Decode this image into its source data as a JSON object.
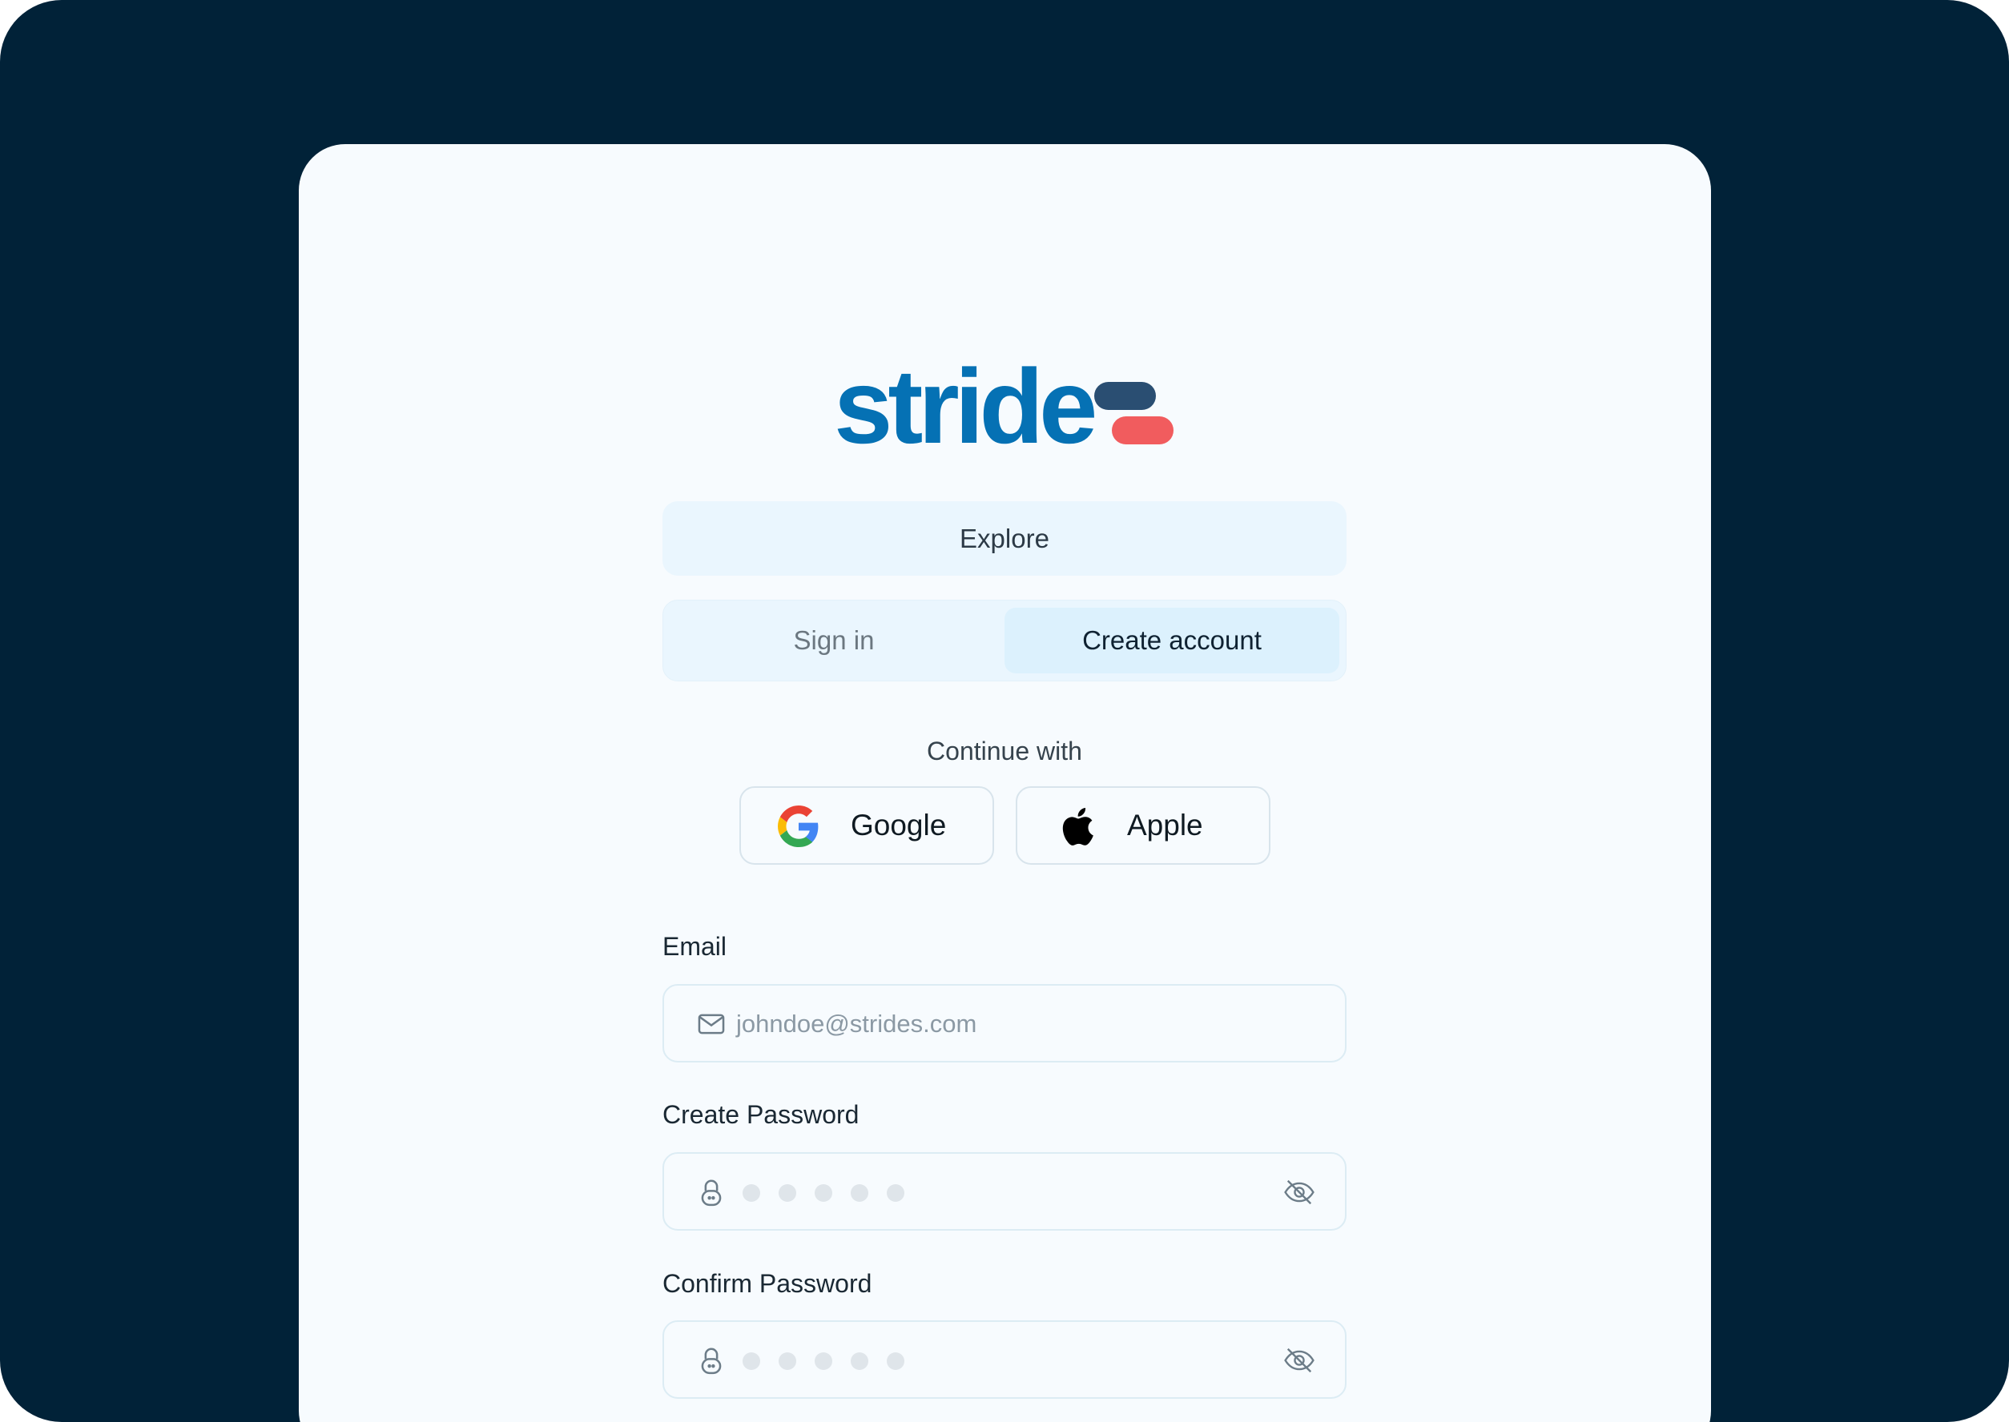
{
  "brand": {
    "logo_text": "stride",
    "colors": {
      "background": "#012238",
      "card": "#f7fbfe",
      "primary": "#0571b4",
      "bar_dark": "#2a4e72",
      "bar_red": "#f15c5e"
    }
  },
  "nav": {
    "explore_label": "Explore"
  },
  "auth_tabs": {
    "sign_in_label": "Sign in",
    "create_account_label": "Create account",
    "active": "create_account"
  },
  "social": {
    "continue_label": "Continue with",
    "google": {
      "label": "Google",
      "icon": "google-icon"
    },
    "apple": {
      "label": "Apple",
      "icon": "apple-icon"
    }
  },
  "form": {
    "email": {
      "label": "Email",
      "placeholder": "johndoe@strides.com",
      "icon": "mail-icon"
    },
    "password": {
      "label": "Create Password",
      "masked_length": 5,
      "icon": "lock-icon",
      "toggle_icon": "eye-off-icon"
    },
    "confirm_password": {
      "label": "Confirm Password",
      "masked_length": 5,
      "icon": "lock-icon",
      "toggle_icon": "eye-off-icon"
    }
  }
}
